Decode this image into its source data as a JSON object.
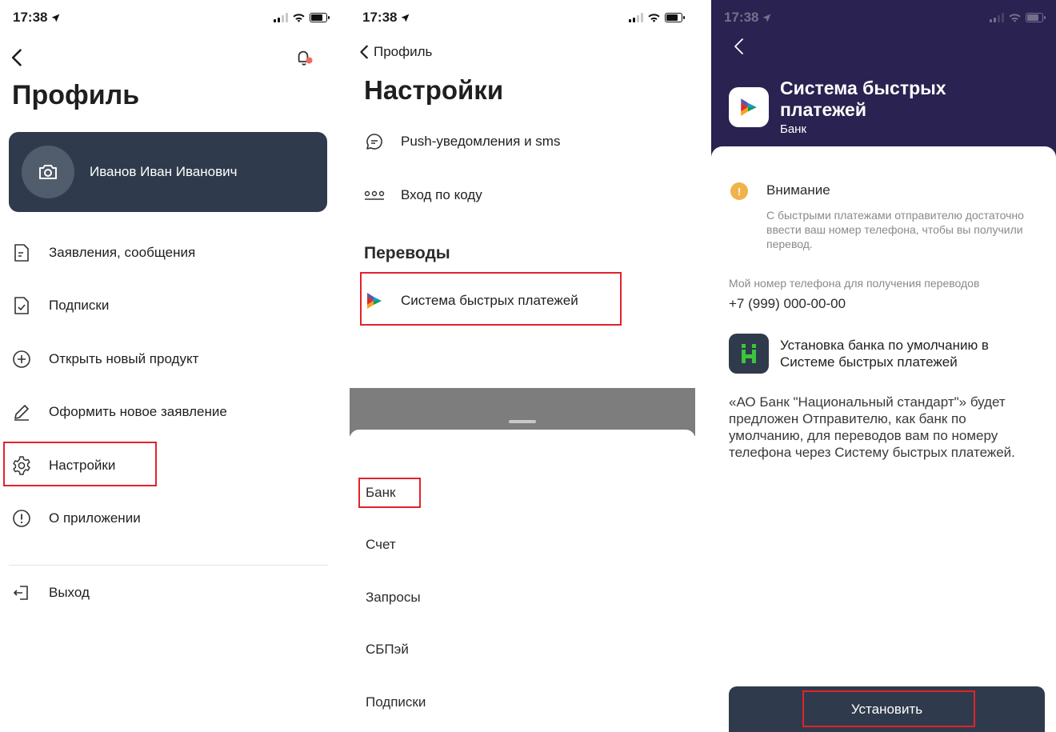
{
  "status": {
    "time": "17:38"
  },
  "profile": {
    "title": "Профиль",
    "user_name": "Иванов Иван Иванович",
    "menu": [
      {
        "label": "Заявления, сообщения",
        "icon": "document-icon"
      },
      {
        "label": "Подписки",
        "icon": "document-check-icon"
      },
      {
        "label": "Открыть новый продукт",
        "icon": "plus-circle-icon"
      },
      {
        "label": "Оформить новое заявление",
        "icon": "pencil-icon"
      },
      {
        "label": "Настройки",
        "icon": "gear-icon"
      },
      {
        "label": "О приложении",
        "icon": "info-circle-icon"
      }
    ],
    "logout": "Выход"
  },
  "settings": {
    "back_label": "Профиль",
    "title": "Настройки",
    "rows": [
      {
        "label": "Push-уведомления и sms",
        "icon": "chat-bubble-icon"
      },
      {
        "label": "Вход по коду",
        "icon": "pin-code-icon"
      }
    ],
    "section_title": "Переводы",
    "sbp_label": "Система быстрых платежей",
    "sheet_items": [
      "Банк",
      "Счет",
      "Запросы",
      "СБПэй",
      "Подписки"
    ]
  },
  "sbp": {
    "title": "Система быстрых платежей",
    "subtitle": "Банк",
    "warning_title": "Внимание",
    "warning_text": "С быстрыми платежами отправителю достаточно ввести ваш номер телефона, чтобы вы получили перевод.",
    "phone_label": "Мой номер телефона для получения переводов",
    "phone_value": "+7 (999) 000-00-00",
    "bank_default_text": "Установка банка по умолчанию в Системе быстрых платежей",
    "description": "«АО Банк \"Национальный стандарт\"» будет предложен Отправителю, как банк по умолчанию, для переводов вам по номеру телефона через Систему быстрых платежей.",
    "install_button": "Установить"
  },
  "colors": {
    "card_bg": "#2f3b4c",
    "sbp_header_bg": "#2a2250",
    "highlight": "#e0242b",
    "warning": "#f0b24a",
    "bank_logo_green": "#3cc43c"
  }
}
